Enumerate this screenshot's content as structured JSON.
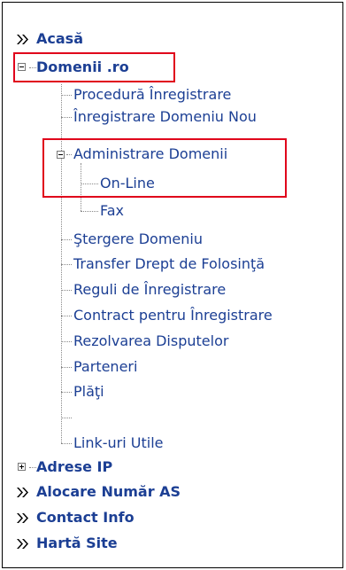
{
  "colors": {
    "link": "#1c3f94",
    "highlight": "#e0001b",
    "border": "#000000"
  },
  "menu": {
    "acasa": "Acasă",
    "domenii": "Domenii .ro",
    "sub": {
      "procedura": "Procedură Înregistrare",
      "inregistrare_nou": "Înregistrare Domeniu Nou",
      "administrare": "Administrare Domenii",
      "online": "On-Line",
      "fax": "Fax",
      "stergere": "Ştergere Domeniu",
      "transfer": "Transfer Drept de Folosinţă",
      "reguli": "Reguli de Înregistrare",
      "contract": "Contract pentru Înregistrare",
      "rezolvarea": "Rezolvarea Disputelor",
      "parteneri": "Parteneri",
      "plati": "Plăţi",
      "linkuri": "Link-uri Utile"
    },
    "adrese_ip": "Adrese IP",
    "alocare": "Alocare Număr AS",
    "contact": "Contact Info",
    "harta": "Hartă Site"
  }
}
